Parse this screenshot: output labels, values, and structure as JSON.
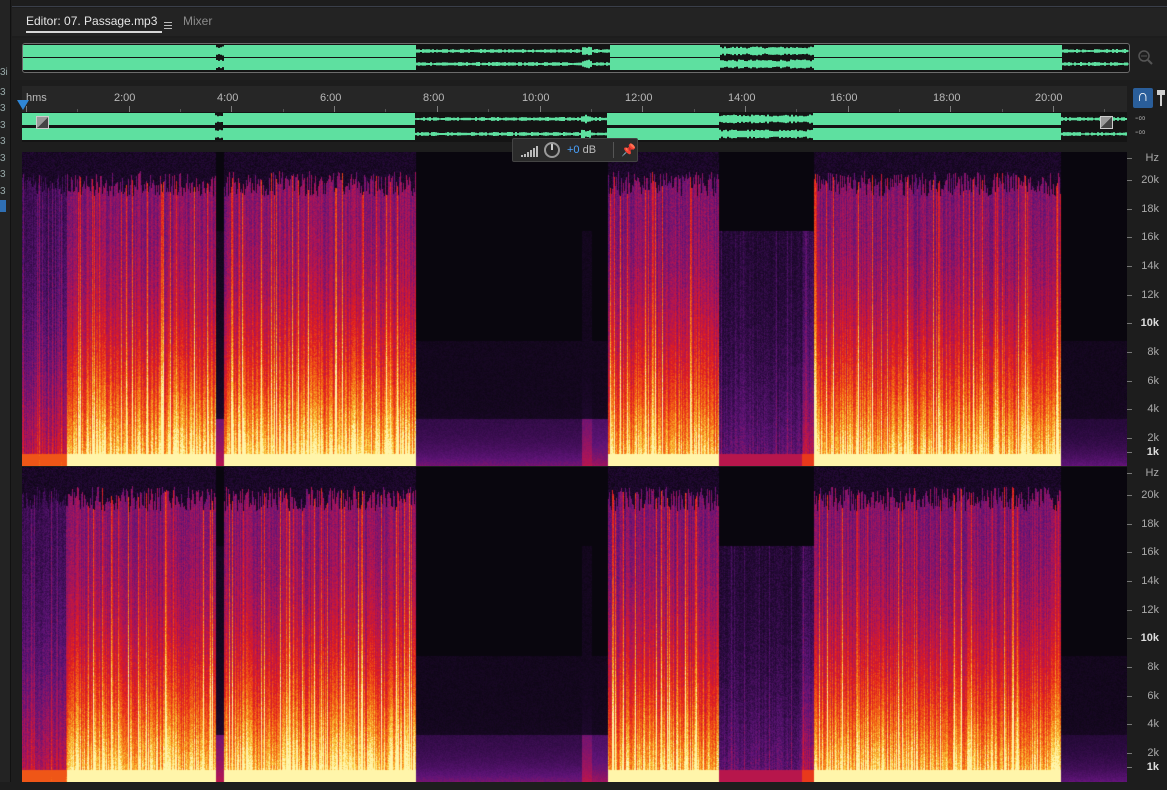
{
  "tabs": {
    "editor_label": "Editor: 07. Passage.mp3",
    "mixer_label": "Mixer"
  },
  "left_strip": [
    "3i",
    "3",
    "3",
    "3",
    "3",
    "3",
    "3",
    "3"
  ],
  "ruler": {
    "unit_label": "hms",
    "labels": [
      "2:00",
      "4:00",
      "6:00",
      "8:00",
      "10:00",
      "12:00",
      "14:00",
      "16:00",
      "18:00",
      "20:00"
    ]
  },
  "db_labels": [
    "-∞",
    "-∞"
  ],
  "hud": {
    "gain_value": "+0",
    "gain_unit": "dB"
  },
  "freq_axis": {
    "unit": "Hz",
    "labels": [
      "20k",
      "18k",
      "16k",
      "14k",
      "12k",
      "10k",
      "8k",
      "6k",
      "4k",
      "2k",
      "1k"
    ]
  },
  "colors": {
    "waveform": "#5ee0a0",
    "accent": "#2f86d6",
    "background": "#1d1d1d"
  },
  "icons": {
    "zoom": "zoom-icon",
    "headphone": "headphone-icon",
    "marker": "marker-icon",
    "pin": "pin-icon"
  }
}
